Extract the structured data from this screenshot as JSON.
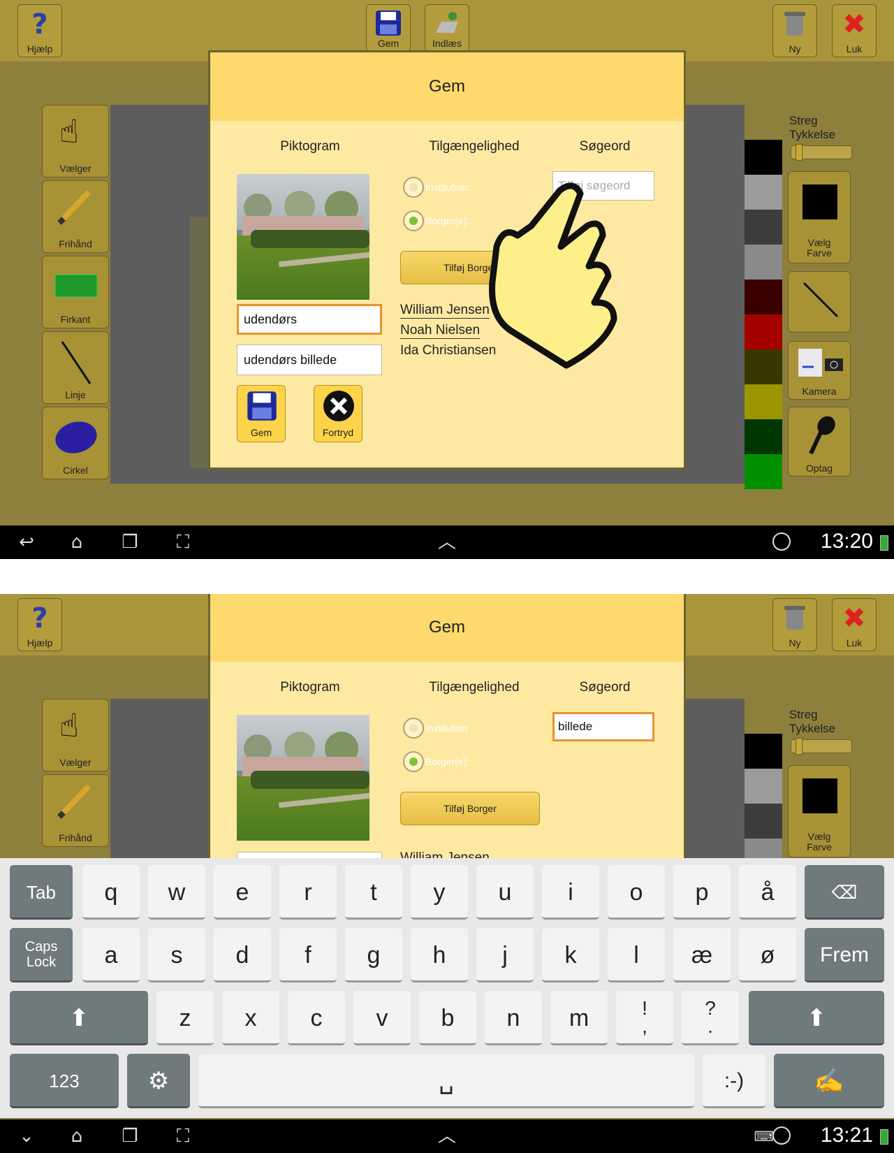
{
  "toolbar": {
    "help": "Hjælp",
    "save": "Gem",
    "load": "Indlæs",
    "new": "Ny",
    "close": "Luk"
  },
  "tools": [
    "Vælger",
    "Frihånd",
    "Firkant",
    "Linje",
    "Cirkel"
  ],
  "right_panel": {
    "stroke_label_1": "Streg",
    "stroke_label_2": "Tykkelse",
    "choose_color_1": "Vælg",
    "choose_color_2": "Farve",
    "camera": "Kamera",
    "record": "Optag"
  },
  "colors": {
    "swatches": [
      "#000000",
      "#9b9b9b",
      "#3d3d3d",
      "#8a8a8a",
      "#3a0000",
      "#a40000",
      "#3a3600",
      "#9a9600",
      "#003600",
      "#009000"
    ],
    "toolbar_bg": "#a8953c",
    "dialog_bg": "#fee9a3",
    "dialog_header": "#fed96d",
    "focus_border": "#e9922b"
  },
  "dialog": {
    "title": "Gem",
    "col_pictogram": "Piktogram",
    "col_access": "Tilgængelighed",
    "col_keywords": "Søgeord",
    "name_value": "udendørs",
    "description_value": "udendørs billede",
    "save_btn": "Gem",
    "cancel_btn": "Fortryd",
    "radio_institution": "Institution:",
    "radio_citizen": "Borger(e):",
    "add_citizen_btn": "Tilføj Borger",
    "citizens": [
      "William Jensen",
      "Noah Nielsen",
      "Ida Christiansen"
    ],
    "keyword_placeholder": "Tilføj søgeord",
    "keyword_value": "billede"
  },
  "statusbar": {
    "time_1": "13:20",
    "time_2": "13:21"
  },
  "keyboard": {
    "row1": [
      "q",
      "w",
      "e",
      "r",
      "t",
      "y",
      "u",
      "i",
      "o",
      "p",
      "å"
    ],
    "row2": [
      "a",
      "s",
      "d",
      "f",
      "g",
      "h",
      "j",
      "k",
      "l",
      "æ",
      "ø"
    ],
    "row3": [
      "z",
      "x",
      "c",
      "v",
      "b",
      "n",
      "m",
      "!\n,",
      "?\n."
    ],
    "tab": "Tab",
    "caps_1": "Caps",
    "caps_2": "Lock",
    "enter": "Frem",
    "numbers": "123",
    "smiley": ":-)"
  }
}
